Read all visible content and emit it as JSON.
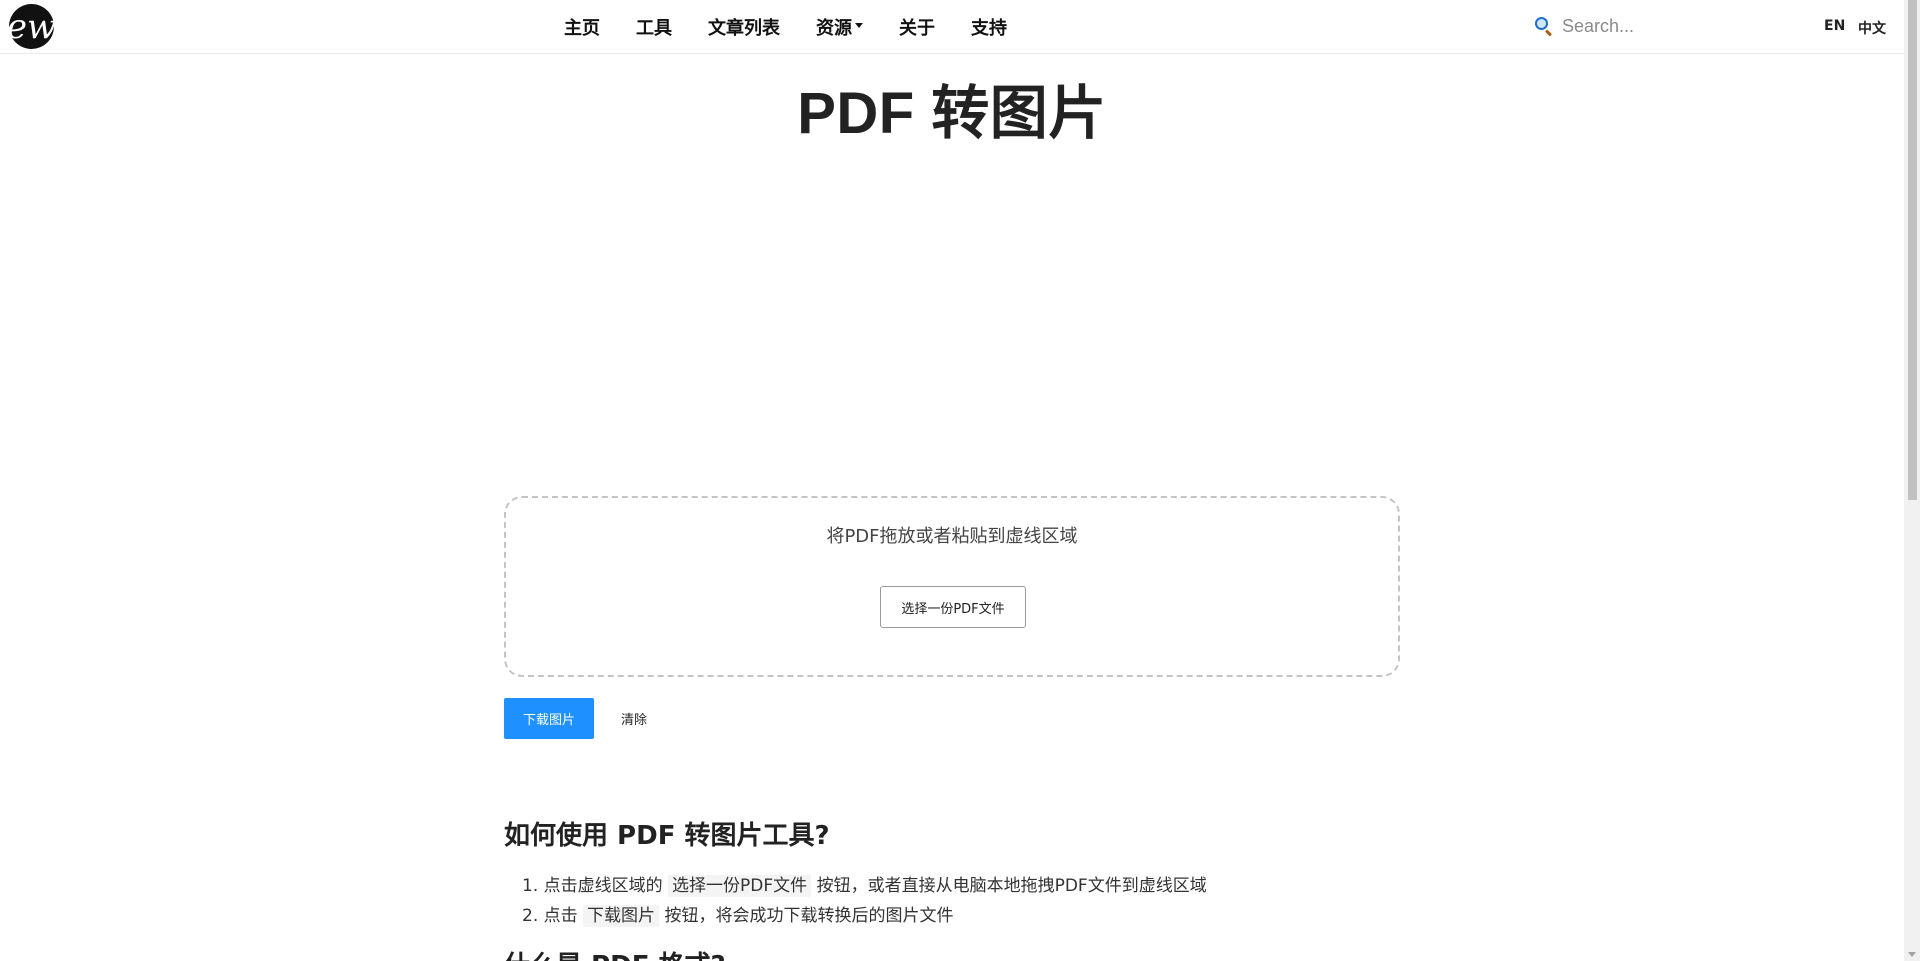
{
  "nav": {
    "logo_letter": "ew",
    "links": [
      {
        "label": "主页"
      },
      {
        "label": "工具"
      },
      {
        "label": "文章列表"
      },
      {
        "label": "资源"
      },
      {
        "label": "关于"
      },
      {
        "label": "支持"
      }
    ],
    "search_placeholder": "Search...",
    "lang_en": "EN",
    "lang_zh": "中文"
  },
  "page": {
    "title": "PDF 转图片"
  },
  "dropzone": {
    "hint": "将PDF拖放或者粘贴到虚线区域",
    "select_button": "选择一份PDF文件"
  },
  "actions": {
    "download_label": "下载图片",
    "clear_label": "清除"
  },
  "howto": {
    "heading": "如何使用 PDF 转图片工具?",
    "steps": [
      {
        "num": "1.",
        "pre": "点击虚线区域的 ",
        "code": "选择一份PDF文件",
        "post": " 按钮，或者直接从电脑本地拖拽PDF文件到虚线区域"
      },
      {
        "num": "2.",
        "pre": "点击 ",
        "code": "下载图片",
        "post": " 按钮，将会成功下载转换后的图片文件"
      }
    ]
  },
  "next_heading": "什么是 PDF 格式?",
  "colors": {
    "accent": "#1e90ff",
    "title": "#222222",
    "dropzone_border": "#c4c4c4"
  }
}
